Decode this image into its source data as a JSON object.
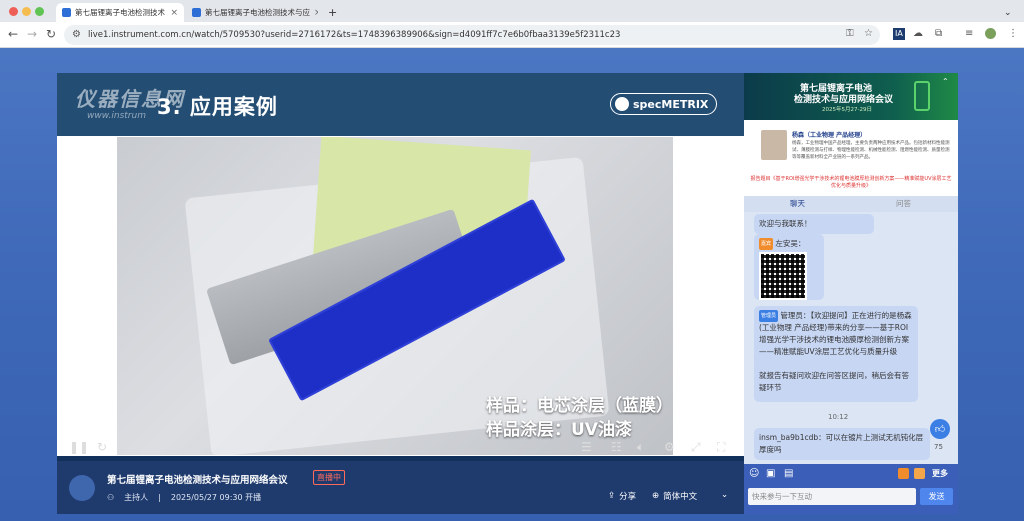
{
  "browser": {
    "tabs": [
      {
        "title": "第七届锂离子电池检测技术",
        "active": true
      },
      {
        "title": "第七届锂离子电池检测技术与应",
        "active": false
      }
    ],
    "url": "live1.instrument.com.cn/watch/5709530?userid=2716172&ts=1748396389906&sign=d4091ff7c7e6b0fbaa3139e5f2311c23",
    "ext_badge": "IA"
  },
  "slide": {
    "title": "3. 应用案例",
    "watermark": "仪器信息网",
    "watermark_url": "www.instrum",
    "brand": "specMETRIX",
    "caption_line1": "样品：电芯涂层（蓝膜）",
    "caption_line2": "样品涂层：UV油漆"
  },
  "stream": {
    "title": "第七届锂离子电池检测技术与应用网络会议",
    "status": "直播中",
    "host": "主持人",
    "time": "2025/05/27 09:30 开播",
    "share_label": "分享",
    "lang_label": "简体中文"
  },
  "sidebar": {
    "banner_line1": "第七届锂离子电池",
    "banner_line2": "检测技术与应用网络会议",
    "banner_date": "2025年5月27-29日",
    "speaker_name": "杨森（工业物理 产品经理）",
    "speaker_desc": "杨森，工业物理中国产品经理，主要负责两种应用技术产品。包括新材料性能测试、薄膜检测与打样、物理性能检测、机械性能检测、阻燃性能检测、质量检测等等覆盖新材料全产业链的一系列产品。",
    "topic": "报告题目《基于ROI增强光学干涉技术的锂电池膜厚检测创新方案——精准赋能UV涂层工艺优化与质量升级》",
    "tab_chat": "聊天",
    "tab_qa": "问答",
    "messages": [
      {
        "user": "",
        "tag": "",
        "text": "欢迎与我联系！"
      },
      {
        "user": "左安吴：",
        "tag": "嘉宾",
        "text": ""
      },
      {
        "user": "管理员：",
        "tag": "管理员",
        "text": "【欢迎提问】正在进行的是杨森(工业物理 产品经理)带来的分享——基于ROI增强光学干涉技术的锂电池膜厚检测创新方案——精准赋能UV涂层工艺优化与质量升级\n\n就报告有疑问欢迎在问答区提问，稍后会有答疑环节"
      },
      {
        "user": "insm_ba9b1cdb：",
        "tag": "",
        "text": "可以在镀片上测试无机钝化层厚度吗"
      }
    ],
    "time_divider": "10:12",
    "likes": "75",
    "more_label": "更多",
    "input_placeholder": "快来参与一下互动",
    "send_label": "发送"
  }
}
